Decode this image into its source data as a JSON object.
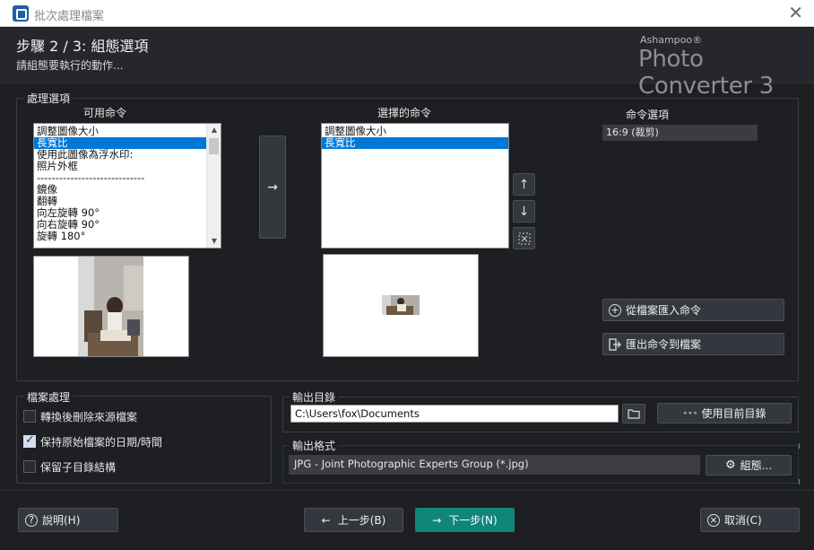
{
  "window": {
    "title": "批次處理檔案",
    "close_glyph": "✕"
  },
  "header": {
    "step": "步驟 2 / 3: 組態選項",
    "subtitle": "請組態要執行的動作...",
    "brand_small": "Ashampoo®",
    "brand_big": "Photo Converter 3"
  },
  "processing": {
    "group_label": "處理選項",
    "available_header": "可用命令",
    "selected_header": "選擇的命令",
    "options_header": "命令選項",
    "available_items": [
      {
        "label": "調整圖像大小",
        "selected": false
      },
      {
        "label": "長寬比",
        "selected": true
      },
      {
        "label": "使用此圖像為浮水印:",
        "selected": false
      },
      {
        "label": "照片外框",
        "selected": false
      },
      {
        "label": "-----------------------------",
        "selected": false
      },
      {
        "label": "鏡像",
        "selected": false
      },
      {
        "label": "翻轉",
        "selected": false
      },
      {
        "label": "向左旋轉 90°",
        "selected": false
      },
      {
        "label": "向右旋轉 90°",
        "selected": false
      },
      {
        "label": "旋轉 180°",
        "selected": false
      }
    ],
    "selected_items": [
      {
        "label": "調整圖像大小",
        "selected": false
      },
      {
        "label": "長寬比",
        "selected": true
      }
    ],
    "option_value": "16:9 (裁剪)",
    "add_glyph": "→",
    "up_glyph": "↑",
    "down_glyph": "↓",
    "import_label": "從檔案匯入命令",
    "export_label": "匯出命令到檔案"
  },
  "file_handling": {
    "group_label": "檔案處理",
    "options": [
      {
        "label": "轉換後刪除來源檔案",
        "checked": false
      },
      {
        "label": "保持原始檔案的日期/時間",
        "checked": true
      },
      {
        "label": "保留子目錄結構",
        "checked": false
      }
    ]
  },
  "output_dir": {
    "group_label": "輸出目錄",
    "path": "C:\\Users\\fox\\Documents",
    "use_current_label": "使用目前目錄",
    "dots_glyph": "∘∘∘"
  },
  "output_format": {
    "group_label": "輸出格式",
    "value": "JPG - Joint Photographic Experts Group (*.jpg)",
    "config_label": "組態..."
  },
  "footer": {
    "help_label": "說明(H)",
    "back_label": "上一步(B)",
    "next_label": "下一步(N)",
    "cancel_label": "取消(C)",
    "help_glyph": "?",
    "cancel_glyph": "×",
    "back_glyph": "←",
    "next_glyph": "→"
  },
  "colors": {
    "accent": "#10857a",
    "selection": "#0078d7",
    "background": "#1e1f23"
  }
}
